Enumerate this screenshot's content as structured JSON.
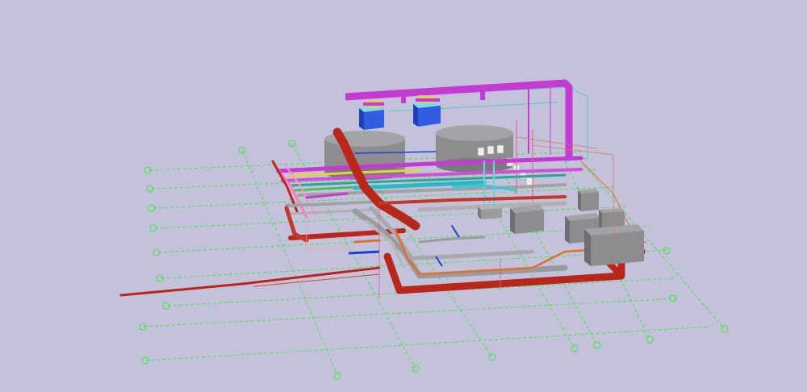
{
  "viewport": {
    "background": "#c4c2da",
    "content": "3d-bim-mep-model"
  },
  "colors": {
    "grid": "#38e83a",
    "magenta_duct": "#c53ad0",
    "red_pipe": "#b8261c",
    "gray_equipment": "#8d8c8f",
    "gray_dark": "#6f6e72",
    "blue_unit": "#2f5fe0",
    "cyan_unit": "#38c9d8",
    "orange_pipe": "#e0702a",
    "yellow_pipe": "#e6d23a",
    "teal_pipe": "#26a89a",
    "blue_line": "#1e3fd0",
    "pink_line": "#ff7ab8"
  },
  "grid_markers": {
    "left_count": 8,
    "bottom_count": 7,
    "right_count": 4
  },
  "icons": [
    "grid-bubble-icon"
  ]
}
